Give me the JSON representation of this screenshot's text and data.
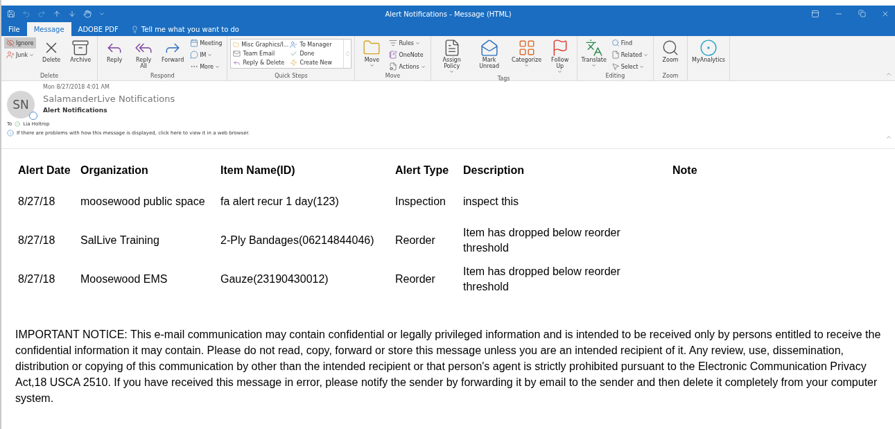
{
  "window": {
    "title": "Alert Notifications  -  Message (HTML)"
  },
  "tabs": [
    {
      "label": "File",
      "selected": false
    },
    {
      "label": "Message",
      "selected": true
    },
    {
      "label": "ADOBE PDF",
      "selected": false
    }
  ],
  "tell_me": {
    "placeholder": "Tell me what you want to do"
  },
  "ribbon": {
    "groups": [
      {
        "label": "Delete",
        "items": [
          {
            "kind": "column",
            "items": [
              {
                "label": "Ignore",
                "dropdown": false,
                "pressed": true
              },
              {
                "label": "Junk",
                "dropdown": true,
                "pressed": false
              }
            ]
          },
          {
            "kind": "large",
            "label": "Delete",
            "dropdown": false
          },
          {
            "kind": "large",
            "label": "Archive",
            "dropdown": false
          }
        ]
      },
      {
        "label": "Respond",
        "items": [
          {
            "kind": "large",
            "label": "Reply",
            "dropdown": false
          },
          {
            "kind": "large",
            "label": "Reply All",
            "dropdown": false
          },
          {
            "kind": "large",
            "label": "Forward",
            "dropdown": false
          },
          {
            "kind": "column",
            "items": [
              {
                "label": "Meeting",
                "dropdown": false,
                "pressed": false
              },
              {
                "label": "IM",
                "dropdown": true,
                "pressed": false
              },
              {
                "label": "More",
                "dropdown": true,
                "pressed": false
              }
            ]
          }
        ]
      },
      {
        "label": "Quick Steps",
        "items": [
          {
            "kind": "gallery",
            "items": [
              {
                "label": "Misc Graphics/I..."
              },
              {
                "label": "To Manager"
              },
              {
                "label": "Team Email"
              },
              {
                "label": "Done"
              },
              {
                "label": "Reply & Delete"
              },
              {
                "label": "Create New"
              }
            ]
          }
        ]
      },
      {
        "label": "Move",
        "items": [
          {
            "kind": "large",
            "label": "Move",
            "dropdown": true
          },
          {
            "kind": "column",
            "items": [
              {
                "label": "Rules",
                "dropdown": true,
                "pressed": false
              },
              {
                "label": "OneNote",
                "dropdown": false,
                "pressed": false
              },
              {
                "label": "Actions",
                "dropdown": true,
                "pressed": false
              }
            ]
          }
        ]
      },
      {
        "label": "Tags",
        "items": [
          {
            "kind": "large",
            "label": "Assign Policy",
            "dropdown": true
          },
          {
            "kind": "large",
            "label": "Mark Unread",
            "dropdown": false
          },
          {
            "kind": "large",
            "label": "Categorize",
            "dropdown": true
          },
          {
            "kind": "large",
            "label": "Follow Up",
            "dropdown": true
          }
        ]
      },
      {
        "label": "Editing",
        "items": [
          {
            "kind": "large",
            "label": "Translate",
            "dropdown": true
          },
          {
            "kind": "column",
            "items": [
              {
                "label": "Find",
                "dropdown": false,
                "pressed": false
              },
              {
                "label": "Related",
                "dropdown": true,
                "pressed": false
              },
              {
                "label": "Select",
                "dropdown": true,
                "pressed": false
              }
            ]
          }
        ]
      },
      {
        "label": "Zoom",
        "items": [
          {
            "kind": "large",
            "label": "Zoom",
            "dropdown": false
          }
        ]
      },
      {
        "items": [
          {
            "kind": "large",
            "label": "MyAnalytics",
            "dropdown": false
          }
        ]
      }
    ]
  },
  "message": {
    "initials": "SN",
    "date": "Mon 8/27/2018 4:01 AM",
    "sender": "SalamanderLive Notifications",
    "subject": "Alert Notifications",
    "to_label": "To",
    "recipient": "Lia Holtrop",
    "info": "If there are problems with how this message is displayed, click here to view it in a web browser."
  },
  "table": {
    "columns": [
      "Alert Date",
      "Organization",
      "Item Name(ID)",
      "Alert Type",
      "Description",
      "Note"
    ],
    "rows": [
      [
        "8/27/18",
        "moosewood public space",
        "fa alert recur 1 day(123)",
        "Inspection",
        "inspect this",
        ""
      ],
      [
        "8/27/18",
        "SalLive Training",
        "2-Ply Bandages(06214844046)",
        "Reorder",
        "Item has dropped below reorder threshold",
        ""
      ],
      [
        "8/27/18",
        "Moosewood EMS",
        "Gauze(23190430012)",
        "Reorder",
        "Item has dropped below reorder threshold",
        ""
      ]
    ]
  },
  "notice": "IMPORTANT NOTICE: This e-mail communication may contain confidential or legally privileged information and is intended to be received only by persons entitled to receive the confidential information it may contain. Please do not read, copy, forward or store this message unless you are an intended recipient of it. Any review, use, dissemination, distribution or copying of this communication by other than the intended recipient or that person's agent is strictly prohibited pursuant to the Electronic Communication Privacy Act,18 USCA 2510. If you have received this message in error, please notify the sender by forwarding it by email to the sender and then delete it completely from your computer system."
}
